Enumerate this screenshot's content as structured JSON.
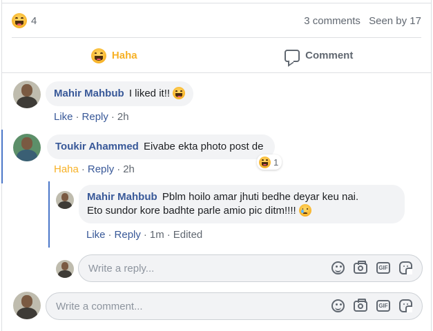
{
  "summary": {
    "reaction_count": "4",
    "comments": "3 comments",
    "seen": "Seen by 17"
  },
  "actions": {
    "haha": "Haha",
    "comment": "Comment"
  },
  "comments": [
    {
      "author": "Mahir Mahbub",
      "text": "I liked it!!",
      "like": "Like",
      "reply": "Reply",
      "time": "2h"
    },
    {
      "author": "Toukir Ahammed",
      "text": "Eivabe ekta photo post de",
      "reaction_label": "Haha",
      "reply": "Reply",
      "time": "2h",
      "reaction_count": "1"
    }
  ],
  "reply": {
    "author": "Mahir Mahbub",
    "line1": "Pblm hoilo amar jhuti bedhe deyar keu nai.",
    "line2": "Eto sundor kore badhte parle amio pic ditm!!!!",
    "like": "Like",
    "reply": "Reply",
    "time": "1m",
    "edited": "Edited"
  },
  "reply_input": {
    "placeholder": "Write a reply..."
  },
  "comment_input": {
    "placeholder": "Write a comment..."
  },
  "input_icons": [
    "emoji-icon",
    "camera-icon",
    "gif-icon",
    "sticker-icon"
  ],
  "gif_label": "GIF",
  "colors": {
    "link": "#385898",
    "haha": "#f7b125",
    "thread_line": "#4a76c8",
    "meta": "#606770"
  }
}
